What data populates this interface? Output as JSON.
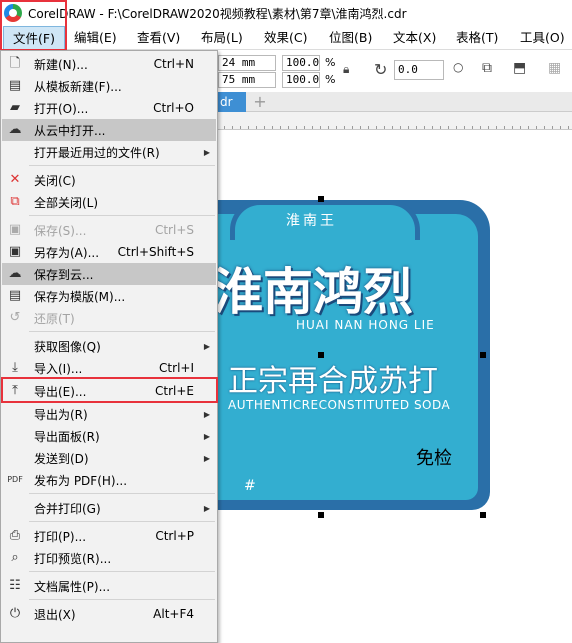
{
  "window": {
    "title": "CorelDRAW - F:\\CorelDRAW2020视频教程\\素材\\第7章\\淮南鸿烈.cdr"
  },
  "menubar": {
    "items": [
      {
        "label": "文件(F)"
      },
      {
        "label": "编辑(E)"
      },
      {
        "label": "查看(V)"
      },
      {
        "label": "布局(L)"
      },
      {
        "label": "效果(C)"
      },
      {
        "label": "位图(B)"
      },
      {
        "label": "文本(X)"
      },
      {
        "label": "表格(T)"
      },
      {
        "label": "工具(O)"
      }
    ]
  },
  "toolbar": {
    "width_value": "24 mm",
    "height_value": "75 mm",
    "scale_x": "100.0",
    "scale_y": "100.0",
    "percent": "%",
    "rotation": "0.0"
  },
  "document_tab": {
    "label": "dr"
  },
  "file_menu": {
    "items": [
      {
        "label": "新建(N)...",
        "shortcut": "Ctrl+N",
        "icon": "new-document-icon",
        "state": "normal"
      },
      {
        "label": "从模板新建(F)...",
        "shortcut": "",
        "icon": "template-icon",
        "state": "normal"
      },
      {
        "label": "打开(O)...",
        "shortcut": "Ctrl+O",
        "icon": "folder-open-icon",
        "state": "normal"
      },
      {
        "label": "从云中打开...",
        "shortcut": "",
        "icon": "cloud-download-icon",
        "state": "highlighted"
      },
      {
        "label": "打开最近用过的文件(R)",
        "shortcut": "",
        "icon": "",
        "state": "submenu"
      },
      {
        "label": "关闭(C)",
        "shortcut": "",
        "icon": "close-document-icon",
        "state": "normal"
      },
      {
        "label": "全部关闭(L)",
        "shortcut": "",
        "icon": "close-all-icon",
        "state": "normal"
      },
      {
        "label": "保存(S)...",
        "shortcut": "Ctrl+S",
        "icon": "save-icon",
        "state": "disabled"
      },
      {
        "label": "另存为(A)...",
        "shortcut": "Ctrl+Shift+S",
        "icon": "save-as-icon",
        "state": "normal"
      },
      {
        "label": "保存到云...",
        "shortcut": "",
        "icon": "cloud-upload-icon",
        "state": "highlighted"
      },
      {
        "label": "保存为模版(M)...",
        "shortcut": "",
        "icon": "save-template-icon",
        "state": "normal"
      },
      {
        "label": "还原(T)",
        "shortcut": "",
        "icon": "revert-icon",
        "state": "disabled"
      },
      {
        "label": "获取图像(Q)",
        "shortcut": "",
        "icon": "",
        "state": "submenu"
      },
      {
        "label": "导入(I)...",
        "shortcut": "Ctrl+I",
        "icon": "import-icon",
        "state": "normal"
      },
      {
        "label": "导出(E)...",
        "shortcut": "Ctrl+E",
        "icon": "export-icon",
        "state": "selected"
      },
      {
        "label": "导出为(R)",
        "shortcut": "",
        "icon": "",
        "state": "submenu"
      },
      {
        "label": "导出面板(R)",
        "shortcut": "",
        "icon": "",
        "state": "submenu"
      },
      {
        "label": "发送到(D)",
        "shortcut": "",
        "icon": "",
        "state": "submenu"
      },
      {
        "label": "发布为 PDF(H)...",
        "shortcut": "",
        "icon": "pdf-icon",
        "state": "normal"
      },
      {
        "label": "合并打印(G)",
        "shortcut": "",
        "icon": "",
        "state": "submenu"
      },
      {
        "label": "打印(P)...",
        "shortcut": "Ctrl+P",
        "icon": "printer-icon",
        "state": "normal"
      },
      {
        "label": "打印预览(R)...",
        "shortcut": "",
        "icon": "print-preview-icon",
        "state": "normal"
      },
      {
        "label": "文档属性(P)...",
        "shortcut": "",
        "icon": "document-properties-icon",
        "state": "normal"
      },
      {
        "label": "退出(X)",
        "shortcut": "Alt+F4",
        "icon": "power-icon",
        "state": "normal"
      }
    ]
  },
  "artwork": {
    "brand": "淮南王",
    "main_title": "淮南鸿烈",
    "pinyin": "HUAI NAN HONG LIE",
    "slogan": "正宗再合成苏打",
    "english": "AUTHENTICRECONSTITUTED SODA",
    "badge": "免检",
    "hash": "#"
  },
  "colors": {
    "label_blue": "#33aed0",
    "label_border": "#2a6fa8",
    "highlight_red": "#e8323c",
    "menu_hover": "#c7c7c7"
  }
}
